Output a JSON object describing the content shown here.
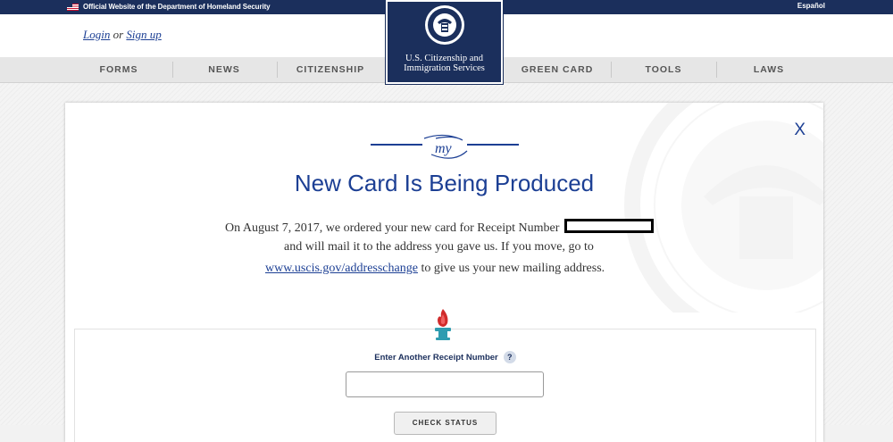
{
  "gov_banner": {
    "official_text": "Official Website of the Department of Homeland Security",
    "language_link": "Español"
  },
  "auth": {
    "login": "Login",
    "or": "or",
    "signup": "Sign up"
  },
  "logo": {
    "line1": "U.S. Citizenship and",
    "line2": "Immigration Services"
  },
  "nav": [
    "FORMS",
    "NEWS",
    "CITIZENSHIP",
    "GREEN CARD",
    "TOOLS",
    "LAWS"
  ],
  "card": {
    "close": "X",
    "flourish": "my",
    "title": "New Card Is Being Produced",
    "message_part1": "On August 7, 2017, we ordered your new card for Receipt Number",
    "message_part2": "and will mail it to the address you gave us. If you move, go to",
    "link": "www.uscis.gov/addresschange",
    "message_part3": "to give us your new mailing address."
  },
  "form": {
    "label": "Enter Another Receipt Number",
    "help": "?",
    "input_value": "",
    "button": "CHECK STATUS"
  },
  "colors": {
    "navy": "#1b2f5c",
    "accent": "#1c3f94"
  }
}
